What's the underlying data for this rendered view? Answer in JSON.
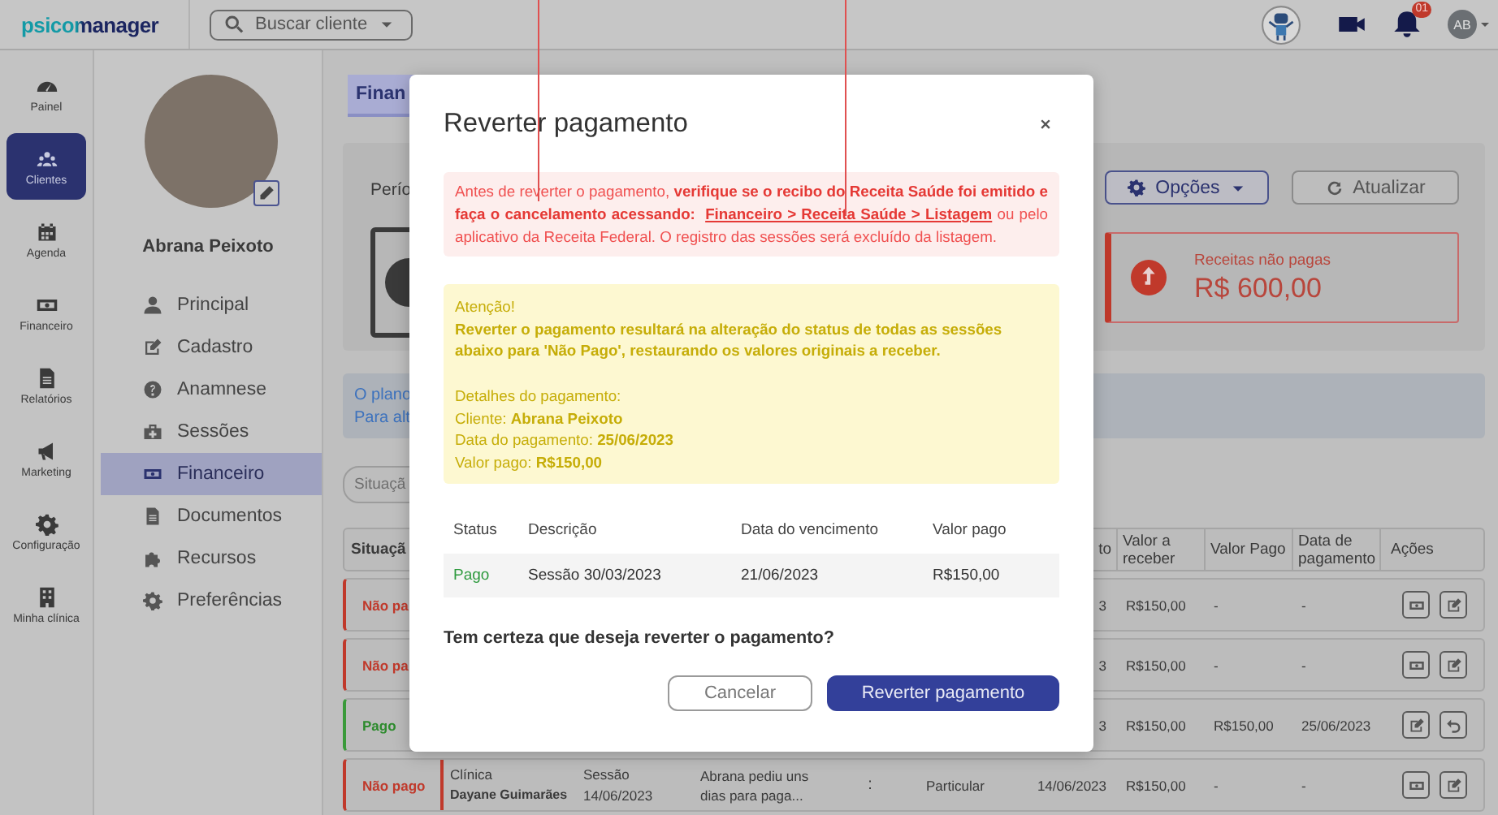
{
  "header": {
    "logo": "psicomanager",
    "search_button": "Buscar cliente",
    "notification_count": "01",
    "avatar_initials": "AB"
  },
  "rail": [
    {
      "label": "Painel",
      "selected": false
    },
    {
      "label": "Clientes",
      "selected": true
    },
    {
      "label": "Agenda",
      "selected": false
    },
    {
      "label": "Financeiro",
      "selected": false
    },
    {
      "label": "Relatórios",
      "selected": false
    },
    {
      "label": "Marketing",
      "selected": false
    },
    {
      "label": "Configuração",
      "selected": false
    },
    {
      "label": "Minha clínica",
      "selected": false
    }
  ],
  "client": {
    "name": "Abrana Peixoto"
  },
  "client_menu": [
    {
      "label": "Principal",
      "selected": false
    },
    {
      "label": "Cadastro",
      "selected": false
    },
    {
      "label": "Anamnese",
      "selected": false
    },
    {
      "label": "Sessões",
      "selected": false
    },
    {
      "label": "Financeiro",
      "selected": true
    },
    {
      "label": "Documentos",
      "selected": false
    },
    {
      "label": "Recursos",
      "selected": false
    },
    {
      "label": "Preferências",
      "selected": false
    }
  ],
  "page": {
    "title_tab": "Finan",
    "period_label": "Perío",
    "options_button": "Opções",
    "refresh_button": "Atualizar",
    "unpaid_card": {
      "label": "Receitas não pagas",
      "value": "R$ 600,00"
    },
    "info_lines": [
      "O plano",
      "Para alt"
    ],
    "filter_field": {
      "placeholder": "Situaçã"
    }
  },
  "table": {
    "columns": [
      "Situaçã",
      "to",
      "Valor a receber",
      "Valor Pago",
      "Data de pagamento",
      "Ações"
    ],
    "rows": [
      {
        "kind": "unpaid",
        "status": "Não pa",
        "due_date": "3",
        "receivable": "R$150,00",
        "paid_value": "-",
        "payment_date": "-",
        "actions": [
          {
            "kind": "pay"
          },
          {
            "kind": "edit"
          }
        ]
      },
      {
        "kind": "unpaid",
        "status": "Não pa",
        "due_date": "3",
        "receivable": "R$150,00",
        "paid_value": "-",
        "payment_date": "-",
        "actions": [
          {
            "kind": "pay"
          },
          {
            "kind": "edit"
          }
        ]
      },
      {
        "kind": "paid",
        "status": "Pago",
        "due_date": "3",
        "receivable": "R$150,00",
        "paid_value": "R$150,00",
        "payment_date": "25/06/2023",
        "actions": [
          {
            "kind": "edit"
          },
          {
            "kind": "undo"
          }
        ]
      },
      {
        "kind": "unpaid",
        "status": "Não pago",
        "clinic_label": "Clínica",
        "professional": "Dayane Guimarães",
        "session_label": "Sessão",
        "session_date": "14/06/2023",
        "description": "Abrana pediu uns dias para paga...",
        "menu": ":",
        "type": "Particular",
        "due_date": "14/06/2023",
        "receivable": "R$150,00",
        "paid_value": "-",
        "payment_date": "-",
        "actions": [
          {
            "kind": "pay"
          },
          {
            "kind": "edit"
          }
        ]
      }
    ]
  },
  "modal": {
    "title": "Reverter pagamento",
    "alert": {
      "before": "Antes de reverter o pagamento, **verifique se o recibo do Receita Saúde foi emitido e faça o cancelamento acessando:** ",
      "link": "Financeiro > Receita Saúde > Listagem",
      "after": " ou pelo aplicativo da Receita Federal. O registro das sessões será excluído da listagem."
    },
    "warning": {
      "heading": "Atenção!",
      "message": "Reverter o pagamento resultará na alteração do status de todas as sessões abaixo para 'Não Pago', restaurando os valores originais a receber.",
      "details": [
        "Detalhes do pagamento:",
        "Cliente: **Abrana Peixoto**",
        "Data do pagamento: **25/06/2023**",
        "Valor pago: **R$150,00**"
      ]
    },
    "table": {
      "columns": [
        "Status",
        "Descrição",
        "Data do vencimento",
        "Valor pago"
      ],
      "rows": [
        {
          "kind": "paid",
          "status": "Pago",
          "description": "Sessão 30/03/2023",
          "due_date": "21/06/2023",
          "paid_value": "R$150,00"
        }
      ]
    },
    "question": "Tem certeza que deseja reverter o pagamento?",
    "buttons": [
      {
        "label": "Cancelar",
        "kind": "secondary"
      },
      {
        "label": "Reverter pagamento",
        "kind": "primary"
      }
    ]
  }
}
